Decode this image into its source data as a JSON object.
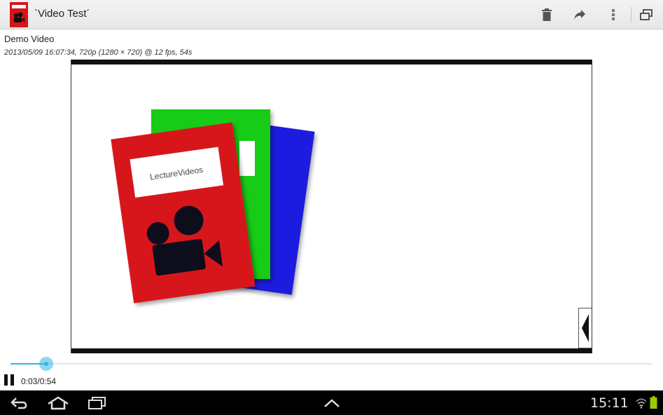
{
  "app": {
    "title": "`Video Test´",
    "icon": "lecturevideos-app-icon"
  },
  "actionbar": {
    "actions": [
      {
        "name": "delete",
        "icon": "trash-icon"
      },
      {
        "name": "share",
        "icon": "share-icon"
      },
      {
        "name": "overflow",
        "icon": "overflow-menu-icon"
      },
      {
        "name": "window",
        "icon": "windows-icon"
      }
    ]
  },
  "video": {
    "title": "Demo Video",
    "meta": "2013/05/09 16:07:34, 720p (1280 × 720) @ 12 fps, 54s",
    "notebook_label": "LectureVideos"
  },
  "player": {
    "progress": 0.056,
    "time": "0:03/0:54",
    "state": "playing"
  },
  "system": {
    "clock": "15:11",
    "nav": [
      "back-icon",
      "home-icon",
      "recents-icon",
      "up-chevron-icon"
    ],
    "colors": {
      "accent": "#33b5e5",
      "battery": "#99cc00"
    }
  }
}
